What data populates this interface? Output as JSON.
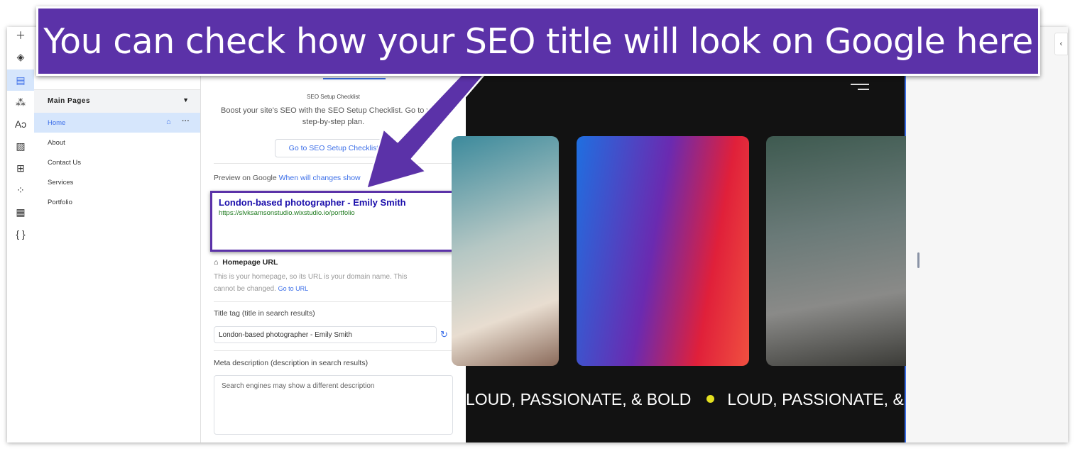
{
  "annotation": {
    "text": "You can check how your SEO title will look on Google here",
    "color": "#5b32a8"
  },
  "rail": {
    "icons": [
      "plus-icon",
      "layers-icon",
      "pages-icon",
      "connections-icon",
      "typography-icon",
      "media-icon",
      "apps-icon",
      "widgets-icon",
      "cms-table-icon",
      "code-braces-icon"
    ],
    "active": "pages-icon"
  },
  "pages": {
    "section_title": "Main Pages",
    "items": [
      {
        "label": "Home",
        "active": true
      },
      {
        "label": "About"
      },
      {
        "label": "Contact Us"
      },
      {
        "label": "Services"
      },
      {
        "label": "Portfolio"
      }
    ]
  },
  "seo": {
    "checklist_title": "SEO Setup Checklist",
    "checklist_text_1": "Boost your site's SEO with the SEO Setup Checklist. Go to yo",
    "checklist_text_2": "step-by-step plan.",
    "checklist_button": "Go to SEO Setup Checklist",
    "preview_label": "Preview on Google",
    "preview_link": "When will changes show",
    "google_title": "London-based photographer - Emily Smith",
    "google_url": "https://slvksamsonstudio.wixstudio.io/portfolio",
    "homepage_url_title": "Homepage URL",
    "homepage_url_text_1": "This is your homepage, so its URL is your domain name. This",
    "homepage_url_text_2": "cannot be changed.",
    "go_to_url": "Go to URL",
    "title_tag_label": "Title tag (title in search results)",
    "title_tag_value": "London-based photographer - Emily Smith",
    "meta_label": "Meta description (description in search results)",
    "meta_placeholder": "Search engines may show a different description"
  },
  "preview": {
    "marquee_1": "LOUD, PASSIONATE, & BOLD",
    "marquee_2": "LOUD, PASSIONATE, &"
  }
}
